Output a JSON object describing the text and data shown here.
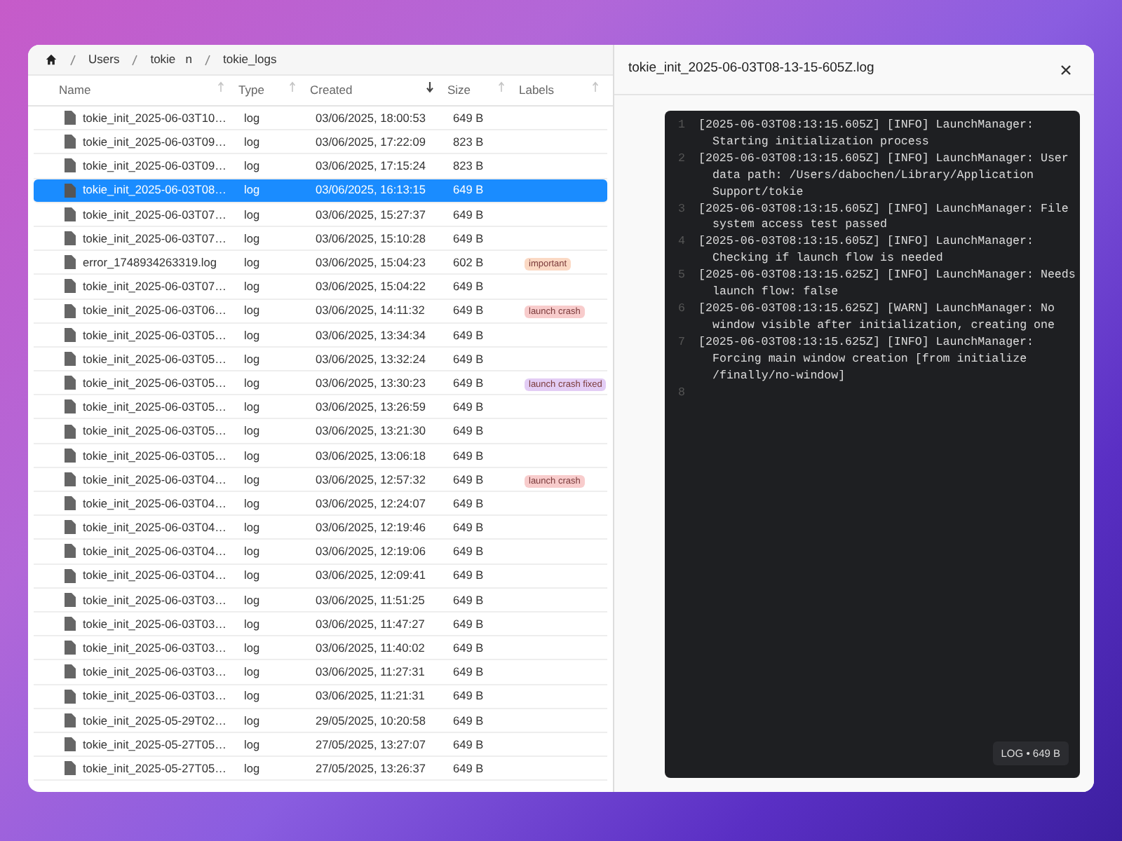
{
  "breadcrumb": [
    "Users",
    "tokie   n",
    "tokie_logs"
  ],
  "table": {
    "columns": [
      {
        "label": "Name",
        "sorted": false
      },
      {
        "label": "Type",
        "sorted": false
      },
      {
        "label": "Created",
        "sorted": true
      },
      {
        "label": "Size",
        "sorted": false
      },
      {
        "label": "Labels",
        "sorted": false
      }
    ],
    "rows": [
      {
        "name": "tokie_init_2025-06-03T10…",
        "type": "log",
        "created": "03/06/2025, 18:00:53",
        "size": "649 B",
        "selected": false,
        "labels": []
      },
      {
        "name": "tokie_init_2025-06-03T09…",
        "type": "log",
        "created": "03/06/2025, 17:22:09",
        "size": "823 B",
        "selected": false,
        "labels": []
      },
      {
        "name": "tokie_init_2025-06-03T09…",
        "type": "log",
        "created": "03/06/2025, 17:15:24",
        "size": "823 B",
        "selected": false,
        "labels": []
      },
      {
        "name": "tokie_init_2025-06-03T08…",
        "type": "log",
        "created": "03/06/2025, 16:13:15",
        "size": "649 B",
        "selected": true,
        "labels": []
      },
      {
        "name": "tokie_init_2025-06-03T07…",
        "type": "log",
        "created": "03/06/2025, 15:27:37",
        "size": "649 B",
        "selected": false,
        "labels": []
      },
      {
        "name": "tokie_init_2025-06-03T07…",
        "type": "log",
        "created": "03/06/2025, 15:10:28",
        "size": "649 B",
        "selected": false,
        "labels": []
      },
      {
        "name": "error_1748934263319.log",
        "type": "log",
        "created": "03/06/2025, 15:04:23",
        "size": "602 B",
        "selected": false,
        "labels": [
          {
            "text": "important",
            "color": "#fbd9c4"
          }
        ]
      },
      {
        "name": "tokie_init_2025-06-03T07…",
        "type": "log",
        "created": "03/06/2025, 15:04:22",
        "size": "649 B",
        "selected": false,
        "labels": []
      },
      {
        "name": "tokie_init_2025-06-03T06…",
        "type": "log",
        "created": "03/06/2025, 14:11:32",
        "size": "649 B",
        "selected": false,
        "labels": [
          {
            "text": "launch crash",
            "color": "#f8cccc"
          }
        ]
      },
      {
        "name": "tokie_init_2025-06-03T05…",
        "type": "log",
        "created": "03/06/2025, 13:34:34",
        "size": "649 B",
        "selected": false,
        "labels": []
      },
      {
        "name": "tokie_init_2025-06-03T05…",
        "type": "log",
        "created": "03/06/2025, 13:32:24",
        "size": "649 B",
        "selected": false,
        "labels": []
      },
      {
        "name": "tokie_init_2025-06-03T05…",
        "type": "log",
        "created": "03/06/2025, 13:30:23",
        "size": "649 B",
        "selected": false,
        "labels": [
          {
            "text": "launch crash fixed",
            "color": "#e3cdf5"
          }
        ]
      },
      {
        "name": "tokie_init_2025-06-03T05…",
        "type": "log",
        "created": "03/06/2025, 13:26:59",
        "size": "649 B",
        "selected": false,
        "labels": []
      },
      {
        "name": "tokie_init_2025-06-03T05…",
        "type": "log",
        "created": "03/06/2025, 13:21:30",
        "size": "649 B",
        "selected": false,
        "labels": []
      },
      {
        "name": "tokie_init_2025-06-03T05…",
        "type": "log",
        "created": "03/06/2025, 13:06:18",
        "size": "649 B",
        "selected": false,
        "labels": []
      },
      {
        "name": "tokie_init_2025-06-03T04…",
        "type": "log",
        "created": "03/06/2025, 12:57:32",
        "size": "649 B",
        "selected": false,
        "labels": [
          {
            "text": "launch crash",
            "color": "#f8cccc"
          }
        ]
      },
      {
        "name": "tokie_init_2025-06-03T04…",
        "type": "log",
        "created": "03/06/2025, 12:24:07",
        "size": "649 B",
        "selected": false,
        "labels": []
      },
      {
        "name": "tokie_init_2025-06-03T04…",
        "type": "log",
        "created": "03/06/2025, 12:19:46",
        "size": "649 B",
        "selected": false,
        "labels": []
      },
      {
        "name": "tokie_init_2025-06-03T04…",
        "type": "log",
        "created": "03/06/2025, 12:19:06",
        "size": "649 B",
        "selected": false,
        "labels": []
      },
      {
        "name": "tokie_init_2025-06-03T04…",
        "type": "log",
        "created": "03/06/2025, 12:09:41",
        "size": "649 B",
        "selected": false,
        "labels": []
      },
      {
        "name": "tokie_init_2025-06-03T03…",
        "type": "log",
        "created": "03/06/2025, 11:51:25",
        "size": "649 B",
        "selected": false,
        "labels": []
      },
      {
        "name": "tokie_init_2025-06-03T03…",
        "type": "log",
        "created": "03/06/2025, 11:47:27",
        "size": "649 B",
        "selected": false,
        "labels": []
      },
      {
        "name": "tokie_init_2025-06-03T03…",
        "type": "log",
        "created": "03/06/2025, 11:40:02",
        "size": "649 B",
        "selected": false,
        "labels": []
      },
      {
        "name": "tokie_init_2025-06-03T03…",
        "type": "log",
        "created": "03/06/2025, 11:27:31",
        "size": "649 B",
        "selected": false,
        "labels": []
      },
      {
        "name": "tokie_init_2025-06-03T03…",
        "type": "log",
        "created": "03/06/2025, 11:21:31",
        "size": "649 B",
        "selected": false,
        "labels": []
      },
      {
        "name": "tokie_init_2025-05-29T02…",
        "type": "log",
        "created": "29/05/2025, 10:20:58",
        "size": "649 B",
        "selected": false,
        "labels": []
      },
      {
        "name": "tokie_init_2025-05-27T05…",
        "type": "log",
        "created": "27/05/2025, 13:27:07",
        "size": "649 B",
        "selected": false,
        "labels": []
      },
      {
        "name": "tokie_init_2025-05-27T05…",
        "type": "log",
        "created": "27/05/2025, 13:26:37",
        "size": "649 B",
        "selected": false,
        "labels": []
      }
    ]
  },
  "viewer": {
    "title": "tokie_init_2025-06-03T08-13-15-605Z.log",
    "lines": [
      {
        "number": "1",
        "text": "[2025-06-03T08:13:15.605Z] [INFO] LaunchManager: Starting initialization process"
      },
      {
        "number": "2",
        "text": "[2025-06-03T08:13:15.605Z] [INFO] LaunchManager: User data path: /Users/dabochen/Library/Application Support/tokie"
      },
      {
        "number": "3",
        "text": "[2025-06-03T08:13:15.605Z] [INFO] LaunchManager: File system access test passed"
      },
      {
        "number": "4",
        "text": "[2025-06-03T08:13:15.605Z] [INFO] LaunchManager: Checking if launch flow is needed"
      },
      {
        "number": "5",
        "text": "[2025-06-03T08:13:15.625Z] [INFO] LaunchManager: Needs launch flow: false"
      },
      {
        "number": "6",
        "text": "[2025-06-03T08:13:15.625Z] [WARN] LaunchManager: No window visible after initialization, creating one"
      },
      {
        "number": "7",
        "text": "[2025-06-03T08:13:15.625Z] [INFO] LaunchManager: Forcing main window creation [from initialize /finally/no-window]"
      },
      {
        "number": "8"
      }
    ],
    "footer": "LOG • 649 B"
  }
}
